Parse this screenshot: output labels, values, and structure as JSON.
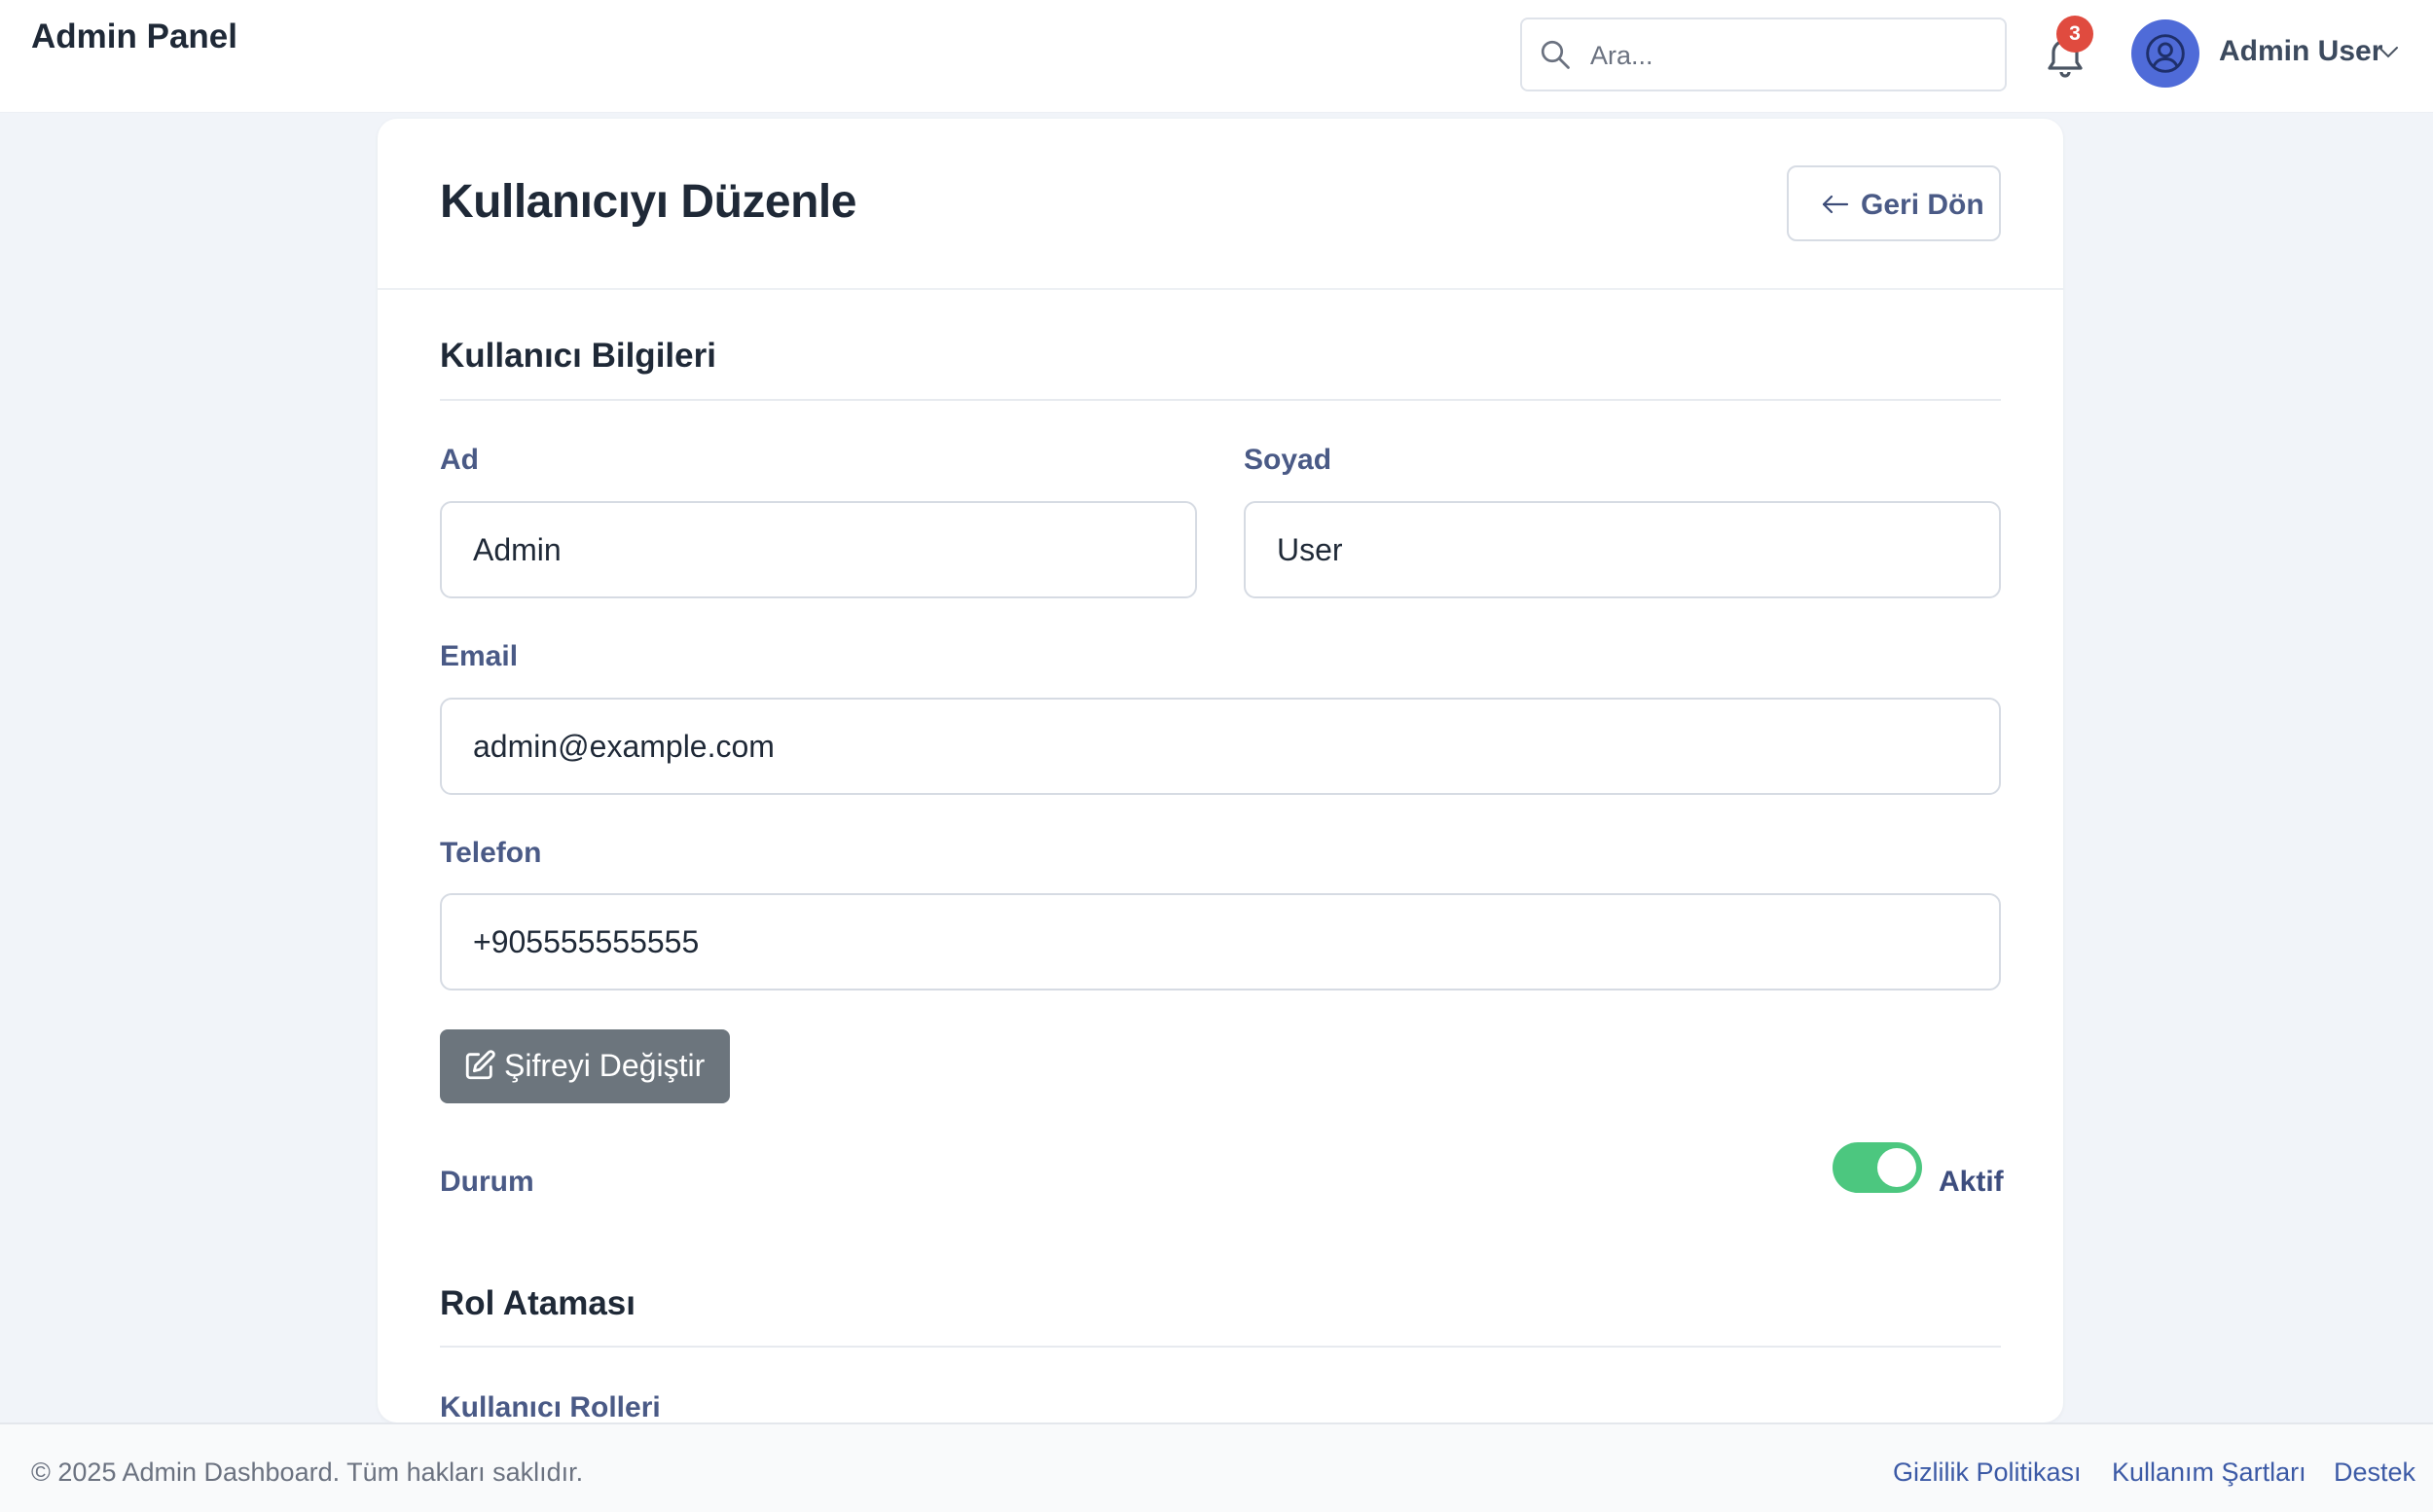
{
  "app": {
    "title": "Admin Panel"
  },
  "header": {
    "search_placeholder": "Ara...",
    "notification_count": "3",
    "user_name": "Admin User"
  },
  "page": {
    "title": "Kullanıcıyı Düzenle",
    "back_label": "Geri Dön"
  },
  "user_info": {
    "section_title": "Kullanıcı Bilgileri",
    "first_name_label": "Ad",
    "first_name_value": "Admin",
    "last_name_label": "Soyad",
    "last_name_value": "User",
    "email_label": "Email",
    "email_value": "admin@example.com",
    "phone_label": "Telefon",
    "phone_value": "+905555555555",
    "change_password_label": "Şifreyi Değiştir",
    "status_label": "Durum",
    "status_value": "Aktif",
    "status_on": true
  },
  "roles": {
    "section_title": "Rol Ataması",
    "user_roles_label": "Kullanıcı Rolleri"
  },
  "footer": {
    "copyright": "© 2025 Admin Dashboard. Tüm hakları saklıdır.",
    "links": [
      "Gizlilik Politikası",
      "Kullanım Şartları",
      "Destek"
    ]
  },
  "colors": {
    "accent": "#4f6bd8",
    "toggle_on": "#4cc77f",
    "badge": "#e04b3f",
    "secondary_button": "#6c757d"
  }
}
